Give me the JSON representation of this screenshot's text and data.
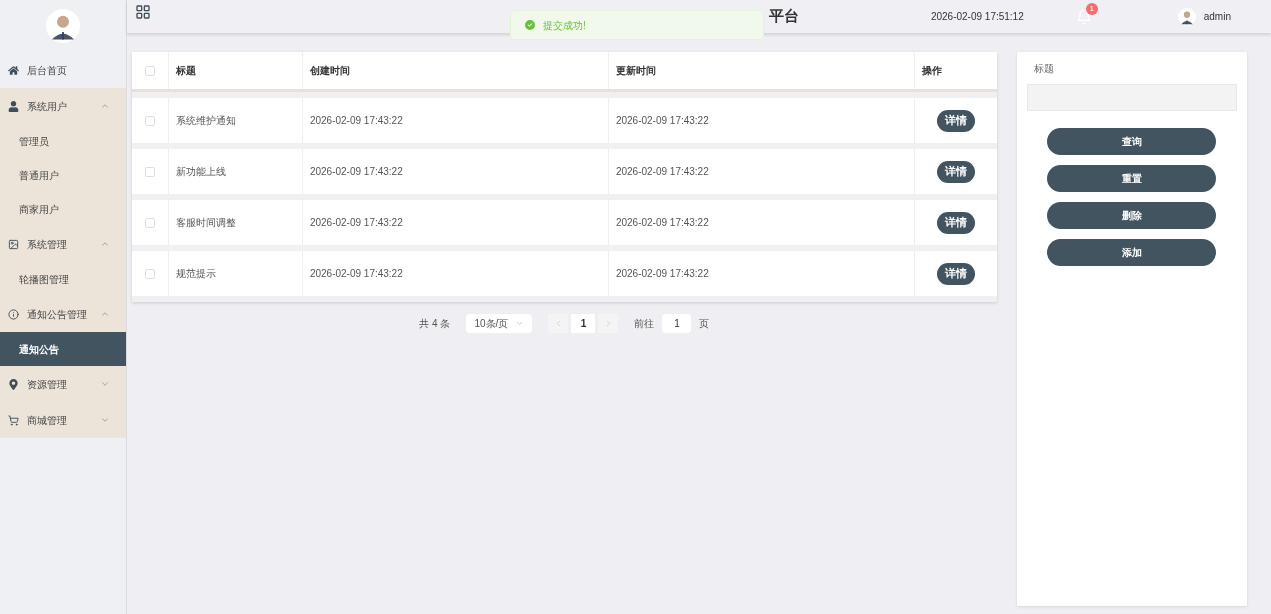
{
  "header": {
    "title": "平台",
    "datetime": "2026-02-09 17:51:12",
    "notifications": "1",
    "user": "admin"
  },
  "toast": {
    "message": "提交成功!"
  },
  "sidebar": {
    "items": [
      {
        "label": "后台首页",
        "kind": "home",
        "selected": false
      },
      {
        "label": "系统用户",
        "kind": "user",
        "expanded": true,
        "children": [
          {
            "label": "管理员",
            "selected": false
          },
          {
            "label": "普通用户",
            "selected": false
          },
          {
            "label": "商家用户",
            "selected": false
          }
        ]
      },
      {
        "label": "系统管理",
        "kind": "image",
        "expanded": true,
        "children": [
          {
            "label": "轮播图管理",
            "selected": false
          }
        ]
      },
      {
        "label": "通知公告管理",
        "kind": "info",
        "expanded": true,
        "children": [
          {
            "label": "通知公告",
            "selected": true
          }
        ]
      },
      {
        "label": "资源管理",
        "kind": "pin",
        "expanded": false
      },
      {
        "label": "商城管理",
        "kind": "cart",
        "expanded": false
      }
    ]
  },
  "table": {
    "select_all_checked": false,
    "columns": [
      "标题",
      "创建时间",
      "更新时间",
      "操作"
    ],
    "rows": [
      {
        "checked": false,
        "title": "系统维护通知",
        "created": "2026-02-09 17:43:22",
        "updated": "2026-02-09 17:43:22",
        "action": "详情"
      },
      {
        "checked": false,
        "title": "新功能上线",
        "created": "2026-02-09 17:43:22",
        "updated": "2026-02-09 17:43:22",
        "action": "详情"
      },
      {
        "checked": false,
        "title": "客服时间调整",
        "created": "2026-02-09 17:43:22",
        "updated": "2026-02-09 17:43:22",
        "action": "详情"
      },
      {
        "checked": false,
        "title": "规范提示",
        "created": "2026-02-09 17:43:22",
        "updated": "2026-02-09 17:43:22",
        "action": "详情"
      }
    ]
  },
  "pagination": {
    "total": "共 4 条",
    "page_size": "10条/页",
    "current_page": "1",
    "goto_label": "前往",
    "goto_value": "1",
    "page_suffix": "页"
  },
  "filter": {
    "label": "标题",
    "buttons": [
      "查询",
      "重置",
      "删除",
      "添加"
    ]
  }
}
